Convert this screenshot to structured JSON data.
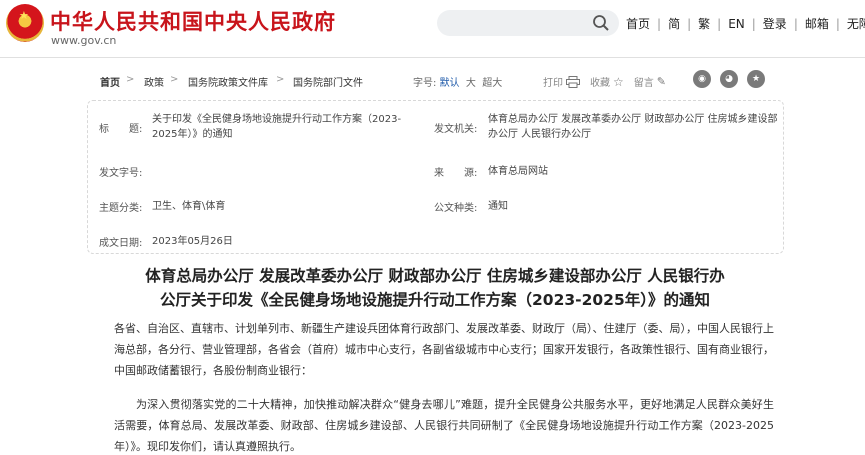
{
  "header": {
    "site_title": "中华人民共和国中央人民政府",
    "site_url": "www.gov.cn",
    "nav": [
      "首页",
      "简",
      "繁",
      "EN",
      "登录",
      "邮箱",
      "无障碍"
    ],
    "nav_sep": "|"
  },
  "breadcrumb": {
    "items": [
      "首页",
      "政策",
      "国务院政策文件库",
      "国务院部门文件"
    ],
    "sep": ">"
  },
  "font_size": {
    "label": "字号:",
    "options": [
      "默认",
      "大",
      "超大"
    ],
    "selected": "默认"
  },
  "tools": {
    "print": "打印",
    "favorite": "收藏",
    "comment": "留言"
  },
  "info": {
    "title_label": "标　　题:",
    "title_value": "关于印发《全民健身场地设施提升行动工作方案（2023-2025年）》的通知",
    "issuer_label": "发文机关:",
    "issuer_value": "体育总局办公厅 发展改革委办公厅 财政部办公厅 住房城乡建设部办公厅 人民银行办公厅",
    "docno_label": "发文字号:",
    "docno_value": "",
    "source_label": "来　　源:",
    "source_value": "体育总局网站",
    "topic_label": "主题分类:",
    "topic_value": "卫生、体育\\体育",
    "type_label": "公文种类:",
    "type_value": "通知",
    "date_label": "成文日期:",
    "date_value": "2023年05月26日"
  },
  "article": {
    "title_line1": "体育总局办公厅 发展改革委办公厅 财政部办公厅 住房城乡建设部办公厅 人民银行办",
    "title_line2": "公厅关于印发《全民健身场地设施提升行动工作方案（2023-2025年）》的通知",
    "recipients": "各省、自治区、直辖市、计划单列市、新疆生产建设兵团体育行政部门、发展改革委、财政厅（局）、住建厅（委、局），中国人民银行上海总部，各分行、营业管理部，各省会（首府）城市中心支行，各副省级城市中心支行；国家开发银行，各政策性银行、国有商业银行，中国邮政储蓄银行，各股份制商业银行：",
    "body": "为深入贯彻落实党的二十大精神，加快推动解决群众“健身去哪儿”难题，提升全民健身公共服务水平，更好地满足人民群众美好生活需要，体育总局、发展改革委、财政部、住房城乡建设部、人民银行共同研制了《全民健身场地设施提升行动工作方案（2023-2025年）》。现印发你们，请认真遵照执行。"
  },
  "colors": {
    "brand_red": "#c8141b",
    "link_blue": "#1a57a8"
  }
}
